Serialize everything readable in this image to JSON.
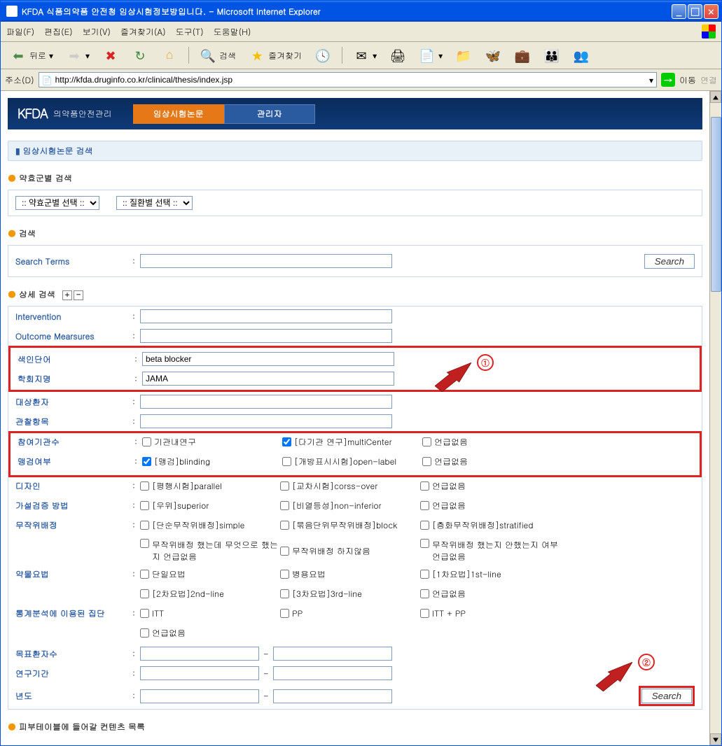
{
  "window": {
    "title": "KFDA 식품의약품 안전청 임상시험정보방입니다. - Microsoft Internet Explorer"
  },
  "menubar": {
    "file": "파일(F)",
    "edit": "편집(E)",
    "view": "보기(V)",
    "favorites": "즐겨찾기(A)",
    "tools": "도구(T)",
    "help": "도움말(H)"
  },
  "toolbar": {
    "back": "뒤로",
    "search": "검색",
    "favorites": "즐겨찾기"
  },
  "addressbar": {
    "label": "주소(D)",
    "url": "http://kfda.druginfo.co.kr/clinical/thesis/index.jsp",
    "go": "이동",
    "links": "연결"
  },
  "kfda": {
    "logo": "KFDA",
    "logo_sub": "의약품안전관리",
    "tab_active": "임상시험논문",
    "tab_inactive": "관리자"
  },
  "sections": {
    "main_title": "임상시험논문 검색",
    "group_search": "약효군별 검색",
    "search": "검색",
    "detail_search": "상세 검색",
    "bottom_title": "피부테이블에 들어갈 컨텐츠 목록"
  },
  "selects": {
    "drug_group": ":: 약효군별 선택 ::",
    "disease": ":: 질환별 선택 ::"
  },
  "labels": {
    "search_terms": "Search Terms",
    "intervention": "Intervention",
    "outcome": "Outcome Mearsures",
    "index_word": "색인단어",
    "journal": "학회지명",
    "subject": "대상환자",
    "obs_item": "관찰항목",
    "inst_count": "참여기관수",
    "blinding": "맹검여부",
    "design": "디자인",
    "hypothesis": "가설검증 방법",
    "randomization": "무작위배정",
    "drug_therapy": "약물요법",
    "stat_group": "통계분석에 이용된 집단",
    "target_patients": "목표환자수",
    "study_period": "연구기간",
    "year": "년도"
  },
  "values": {
    "index_word": "beta blocker",
    "journal": "JAMA"
  },
  "checkboxes": {
    "inst": {
      "internal": "기관내연구",
      "multi": "[다기관 연구]multiCenter",
      "none": "언급없음"
    },
    "blind": {
      "blinding": "[맹검]blinding",
      "open": "[개방표시시험]open-label",
      "none": "언급없음"
    },
    "design": {
      "parallel": "[평행시험]parallel",
      "cross": "[교차시험]corss-over",
      "none": "언급없음"
    },
    "hyp": {
      "superior": "[우위]superior",
      "noninf": "[비열등성]non-inferior",
      "none": "언급없음"
    },
    "rand": {
      "simple": "[단순무작위배정]simple",
      "block": "[묶음단위무작위배정]block",
      "strat": "[층화무작위배정]stratified",
      "what": "무작위배정 했는데 무엇으로 했는지 언급없음",
      "notdone": "무작위배정 하지않음",
      "unknown": "무작위배정 했는지 안했는지 여부 언급없음"
    },
    "drug": {
      "single": "단일요법",
      "combo": "병용요법",
      "first": "[1차요법]1st-line",
      "second": "[2차요법]2nd-line",
      "third": "[3차요법]3rd-line",
      "none": "언급없음"
    },
    "stat": {
      "itt": "ITT",
      "pp": "PP",
      "ittpp": "ITT + PP",
      "none": "언급없음"
    }
  },
  "buttons": {
    "search": "Search"
  },
  "range_sep": "-",
  "annotations": {
    "num1": "①",
    "num2": "②"
  }
}
